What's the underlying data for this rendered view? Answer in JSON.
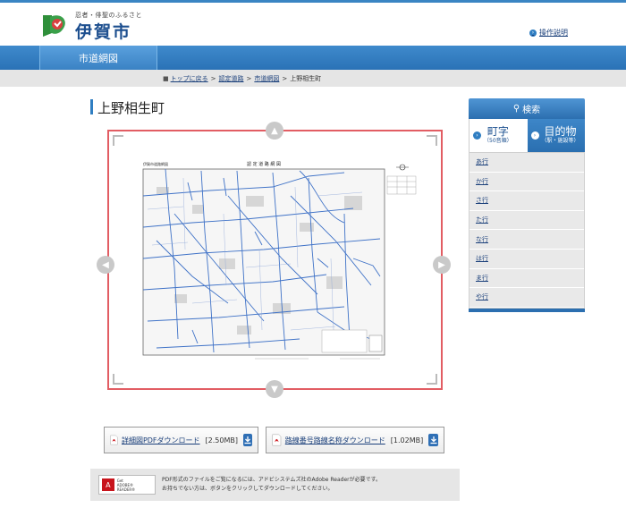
{
  "header": {
    "tagline": "忍者・俳聖のふるさと",
    "logo_text": "伊賀市",
    "help_link": "操作説明"
  },
  "nav": {
    "tab_label": "市道網図"
  },
  "breadcrumb": {
    "home": "トップに戻る",
    "level1": "認定道路",
    "level2": "市道網図",
    "current": "上野相生町",
    "separator": ">"
  },
  "page": {
    "title": "上野相生町"
  },
  "map": {
    "header_left": "伊賀市道路網図",
    "heading": "認 定 道 路 網 図"
  },
  "downloads": [
    {
      "label": "詳細図PDFダウンロード",
      "size": "[2.50MB]"
    },
    {
      "label": "路線番号路線名称ダウンロード",
      "size": "[1.02MB]"
    }
  ],
  "notice": {
    "badge_line1": "Get",
    "badge_line2": "ADOBE® READER®",
    "line1": "PDF形式のファイルをご覧になるには、アドビシステムズ社のAdobe Readerが必要です。",
    "line2": "お持ちでない方は、ボタンをクリックしてダウンロードしてください。"
  },
  "sidebar": {
    "search_title": "検索",
    "tab1_big": "町字",
    "tab1_small": "（50音順）",
    "tab2_big": "目的物",
    "tab2_small": "（駅・施設等）",
    "rows": [
      "あ行",
      "か行",
      "さ行",
      "た行",
      "な行",
      "は行",
      "ま行",
      "や行"
    ]
  },
  "colors": {
    "brand_blue": "#2f7ec2",
    "viewer_border": "#e25d63",
    "map_roads": "#3f72c7"
  }
}
